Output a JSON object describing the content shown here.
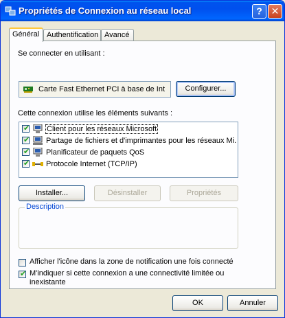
{
  "window": {
    "title": "Propriétés de Connexion au réseau local",
    "help_label": "?",
    "close_label": "✕"
  },
  "tabs": [
    {
      "label": "Général",
      "active": true
    },
    {
      "label": "Authentification",
      "active": false
    },
    {
      "label": "Avancé",
      "active": false
    }
  ],
  "connect_using": {
    "label": "Se connecter en utilisant :",
    "adapter": "Carte Fast Ethernet PCI à base de Int",
    "configure_label": "Configurer..."
  },
  "components": {
    "label": "Cette connexion utilise les éléments suivants :",
    "items": [
      {
        "label": "Client pour les réseaux Microsoft",
        "checked": true,
        "icon": "network-client-icon"
      },
      {
        "label": "Partage de fichiers et d'imprimantes pour les réseaux Mi...",
        "checked": true,
        "icon": "file-printer-sharing-icon"
      },
      {
        "label": "Planificateur de paquets QoS",
        "checked": true,
        "icon": "qos-scheduler-icon"
      },
      {
        "label": "Protocole Internet (TCP/IP)",
        "checked": true,
        "icon": "protocol-icon"
      }
    ]
  },
  "buttons": {
    "install": "Installer...",
    "uninstall": "Désinstaller",
    "properties": "Propriétés"
  },
  "description": {
    "label": "Description"
  },
  "options": [
    {
      "label": "Afficher l'icône dans la zone de notification une fois connecté",
      "checked": false
    },
    {
      "label": "M'indiquer si cette connexion a une connectivité limitée ou inexistante",
      "checked": true
    }
  ],
  "footer": {
    "ok": "OK",
    "cancel": "Annuler"
  },
  "colors": {
    "titlebar": "#0053ee",
    "window_bg": "#ece9d8",
    "tab_highlight": "#ffc83c",
    "group_label": "#0046d5"
  }
}
